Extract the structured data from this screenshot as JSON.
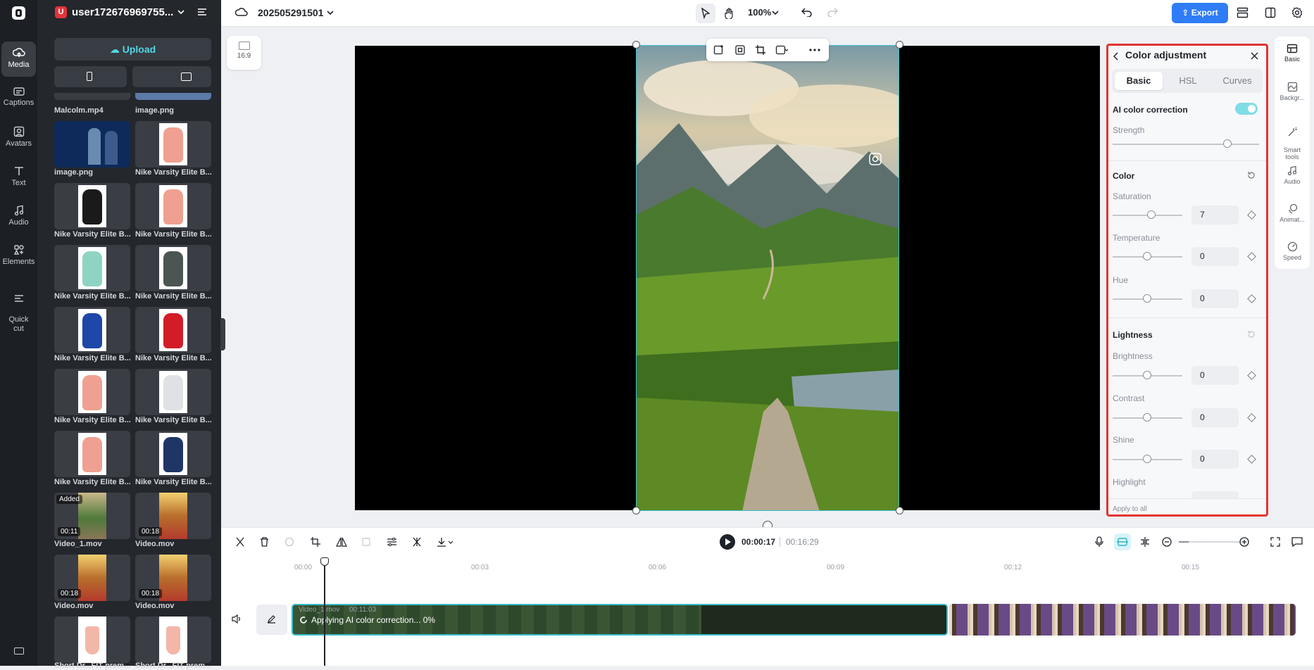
{
  "media_panel": {
    "user_initial": "U",
    "user_name": "user172676969755...",
    "upload_label": "Upload",
    "items": [
      {
        "label": "Malcolm.mp4"
      },
      {
        "label": "image.png"
      },
      {
        "label": "image.png"
      },
      {
        "label": "Nike Varsity Elite B..."
      },
      {
        "label": "Nike Varsity Elite B..."
      },
      {
        "label": "Nike Varsity Elite B..."
      },
      {
        "label": "Nike Varsity Elite B..."
      },
      {
        "label": "Nike Varsity Elite B..."
      },
      {
        "label": "Nike Varsity Elite B..."
      },
      {
        "label": "Nike Varsity Elite B..."
      },
      {
        "label": "Nike Varsity Elite B..."
      },
      {
        "label": "Nike Varsity Elite B..."
      },
      {
        "label": "Nike Varsity Elite B..."
      },
      {
        "label": "Nike Varsity Elite B..."
      },
      {
        "label": "Video_1.mov",
        "badge": "Added",
        "duration": "00:11"
      },
      {
        "label": "Video.mov",
        "duration": "00:18"
      },
      {
        "label": "Video.mov",
        "duration": "00:18"
      },
      {
        "label": "Video.mov",
        "duration": "00:18"
      },
      {
        "label": "Short Dr...FIT prem..."
      },
      {
        "label": "Short Dr...FIT prem..."
      }
    ]
  },
  "rail": [
    {
      "label": "Media"
    },
    {
      "label": "Captions"
    },
    {
      "label": "Avatars"
    },
    {
      "label": "Text"
    },
    {
      "label": "Audio"
    },
    {
      "label": "Elements"
    },
    {
      "label": "Quick\ncut"
    }
  ],
  "topbar": {
    "project_name": "202505291501",
    "zoom": "100%",
    "export_label": "Export"
  },
  "canvas": {
    "ratio_label": "16:9"
  },
  "color_adjustment": {
    "title": "Color adjustment",
    "tabs": [
      "Basic",
      "HSL",
      "Curves"
    ],
    "ai_label": "AI color correction",
    "ai_enabled": true,
    "strength_label": "Strength",
    "strength_value": 0.8,
    "color_section": "Color",
    "saturation_label": "Saturation",
    "saturation_value": "7",
    "temperature_label": "Temperature",
    "temperature_value": "0",
    "hue_label": "Hue",
    "hue_value": "0",
    "lightness_section": "Lightness",
    "brightness_label": "Brightness",
    "brightness_value": "0",
    "contrast_label": "Contrast",
    "contrast_value": "0",
    "shine_label": "Shine",
    "shine_value": "0",
    "highlight_label": "Highlight",
    "apply_all": "Apply to all"
  },
  "right_tools": [
    {
      "label": "Basic"
    },
    {
      "label": "Backgr..."
    },
    {
      "label": "Smart\ntools"
    },
    {
      "label": "Audio"
    },
    {
      "label": "Animat..."
    },
    {
      "label": "Speed"
    }
  ],
  "timeline": {
    "current_time": "00:00:17",
    "total_time": "00:16:29",
    "ruler": [
      "00:00",
      "00:03",
      "00:06",
      "00:09",
      "00:12",
      "00:15"
    ],
    "clip_name": "Video_1.mov",
    "clip_duration": "00:11:03",
    "clip_status": "Applying AI color correction... 0%"
  },
  "colors": {
    "accent": "#2e7df6",
    "selection": "#42c0cc",
    "highlight_border": "#e23434"
  }
}
